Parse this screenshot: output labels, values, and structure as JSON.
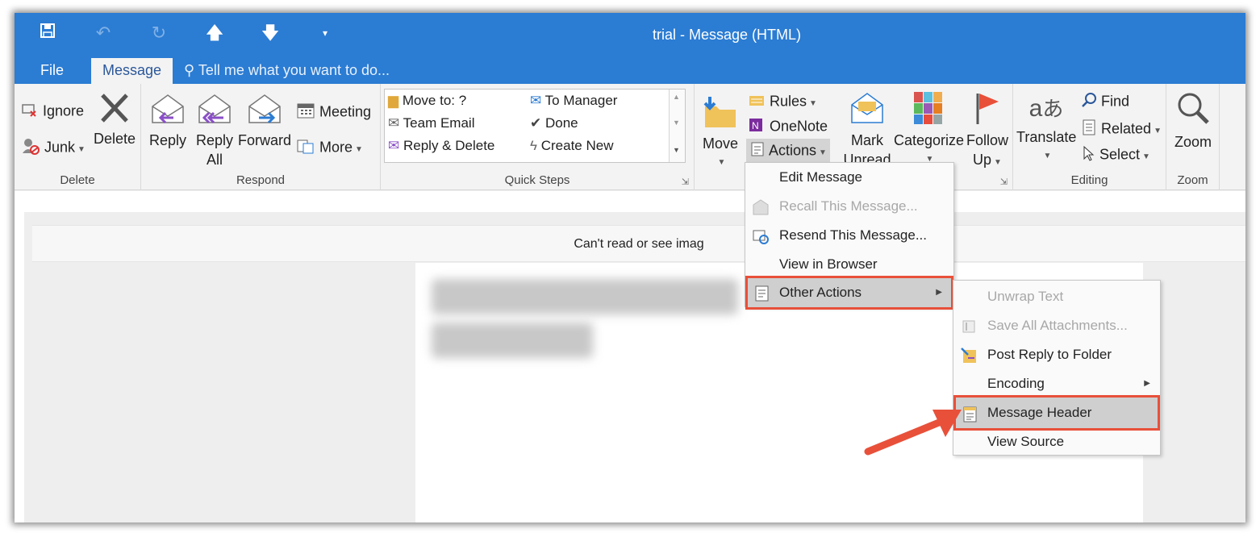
{
  "window": {
    "title": "trial - Message (HTML)"
  },
  "quick_access": [
    "save-icon",
    "undo-icon",
    "redo-icon",
    "up-arrow-icon",
    "down-arrow-icon",
    "customize-caret-icon"
  ],
  "tabs": {
    "file": "File",
    "message": "Message",
    "tell_me": "Tell me what you want to do..."
  },
  "ribbon": {
    "delete_group": {
      "label": "Delete",
      "ignore": "Ignore",
      "junk": "Junk",
      "delete": "Delete"
    },
    "respond_group": {
      "label": "Respond",
      "reply": "Reply",
      "reply_all_1": "Reply",
      "reply_all_2": "All",
      "forward": "Forward",
      "meeting": "Meeting",
      "more": "More"
    },
    "quick_steps_group": {
      "label": "Quick Steps",
      "items": [
        "Move to: ?",
        "Team Email",
        "Reply & Delete",
        "To Manager",
        "Done",
        "Create New"
      ]
    },
    "move_group": {
      "move": "Move",
      "rules": "Rules",
      "onenote": "OneNote",
      "actions": "Actions"
    },
    "tags_group": {
      "mark_1": "Mark",
      "mark_2": "Unread",
      "categorize": "Categorize",
      "follow_1": "Follow",
      "follow_2": "Up"
    },
    "editing_group": {
      "label": "Editing",
      "translate": "Translate",
      "find": "Find",
      "related": "Related",
      "select": "Select"
    },
    "zoom_group": {
      "label": "Zoom",
      "zoom": "Zoom"
    }
  },
  "message": {
    "info_bar": "Can't read or see imag"
  },
  "actions_menu": {
    "edit_message": "Edit Message",
    "recall_message": "Recall This Message...",
    "resend_message": "Resend This Message...",
    "view_in_browser": "View in Browser",
    "other_actions": "Other Actions"
  },
  "other_actions_menu": {
    "unwrap_text": "Unwrap Text",
    "save_all_attachments": "Save All Attachments...",
    "post_reply_to_folder": "Post Reply to Folder",
    "encoding": "Encoding",
    "message_header": "Message Header",
    "view_source": "View Source"
  },
  "colors": {
    "accent": "#2b7cd3",
    "highlight": "#e8503a"
  }
}
